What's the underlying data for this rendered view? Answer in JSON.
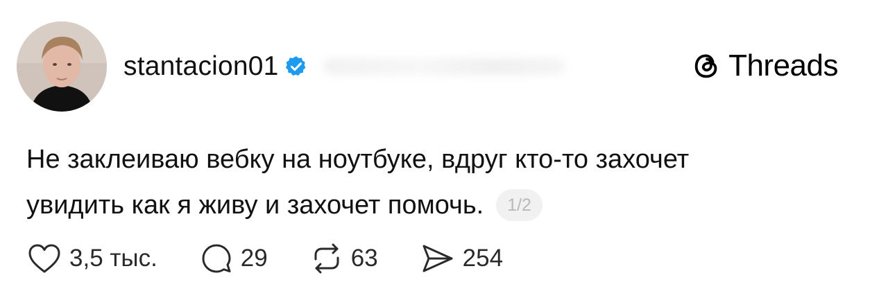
{
  "post": {
    "username": "stantacion01",
    "brand": "Threads",
    "text_line1": "Не заклеиваю вебку на ноутбуке, вдруг кто-то захочет",
    "text_line2": "увидить как я живу и захочет помочь.",
    "page_indicator": "1/2",
    "verified": true
  },
  "actions": {
    "likes": "3,5 тыс.",
    "comments": "29",
    "reposts": "63",
    "shares": "254"
  },
  "colors": {
    "verified_badge": "#1d9bf0",
    "text": "#111111",
    "muted": "#b9b9b9"
  },
  "icons": [
    "heart-icon",
    "comment-icon",
    "repost-icon",
    "share-icon",
    "verified-icon",
    "threads-logo-icon"
  ]
}
